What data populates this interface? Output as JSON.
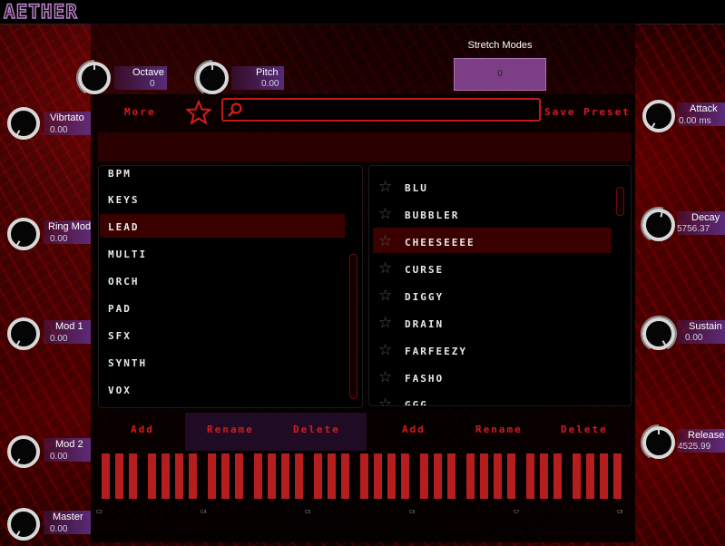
{
  "app": {
    "title": "AETHER"
  },
  "knobs": {
    "vibrato": {
      "label": "Vibrtato",
      "value": "0.00",
      "level": 0
    },
    "ring_mod": {
      "label": "Ring Mod",
      "value": "0.00",
      "level": 0
    },
    "mod1": {
      "label": "Mod 1",
      "value": "0.00",
      "level": 0
    },
    "mod2": {
      "label": "Mod 2",
      "value": "0.00",
      "level": 0
    },
    "master": {
      "label": "Master",
      "value": "0.00",
      "level": 0
    },
    "octave": {
      "label": "Octave",
      "value": "0",
      "level": 0.5
    },
    "pitch": {
      "label": "Pitch",
      "value": "0.00",
      "level": 0.5
    },
    "attack": {
      "label": "Attack",
      "value": "0.00 ms",
      "level": 0
    },
    "decay": {
      "label": "Decay",
      "value": "5756.37",
      "level": 0.55
    },
    "sustain": {
      "label": "Sustain",
      "value": "0.00",
      "level": 1
    },
    "release": {
      "label": "Release",
      "value": "4525.99",
      "level": 0.5
    }
  },
  "stretch": {
    "title": "Stretch Modes",
    "value": "0"
  },
  "browser": {
    "more_label": "More",
    "save_label": "Save Preset",
    "search_placeholder": "",
    "categories": [
      "BPM",
      "KEYS",
      "LEAD",
      "MULTI",
      "ORCH",
      "PAD",
      "SFX",
      "SYNTH",
      "VOX"
    ],
    "selected_category": "LEAD",
    "presets": [
      "BLU",
      "BUBBLER",
      "CHEESEEEE",
      "CURSE",
      "DIGGY",
      "DRAIN",
      "FARFEEZY",
      "FASHO",
      "GGG"
    ],
    "selected_preset": "CHEESEEEE",
    "left_actions": {
      "add": "Add",
      "rename": "Rename",
      "delete": "Delete"
    },
    "right_actions": {
      "add": "Add",
      "rename": "Rename",
      "delete": "Delete"
    }
  },
  "keyboard": {
    "octave_labels": [
      "C3",
      "C4",
      "C5",
      "C6",
      "C7",
      "C8"
    ]
  },
  "colors": {
    "accent_red": "#d51c1c",
    "key_red": "#b41e1e",
    "param_purple": "#5f328c",
    "stretch_purple": "#7c3f86"
  }
}
